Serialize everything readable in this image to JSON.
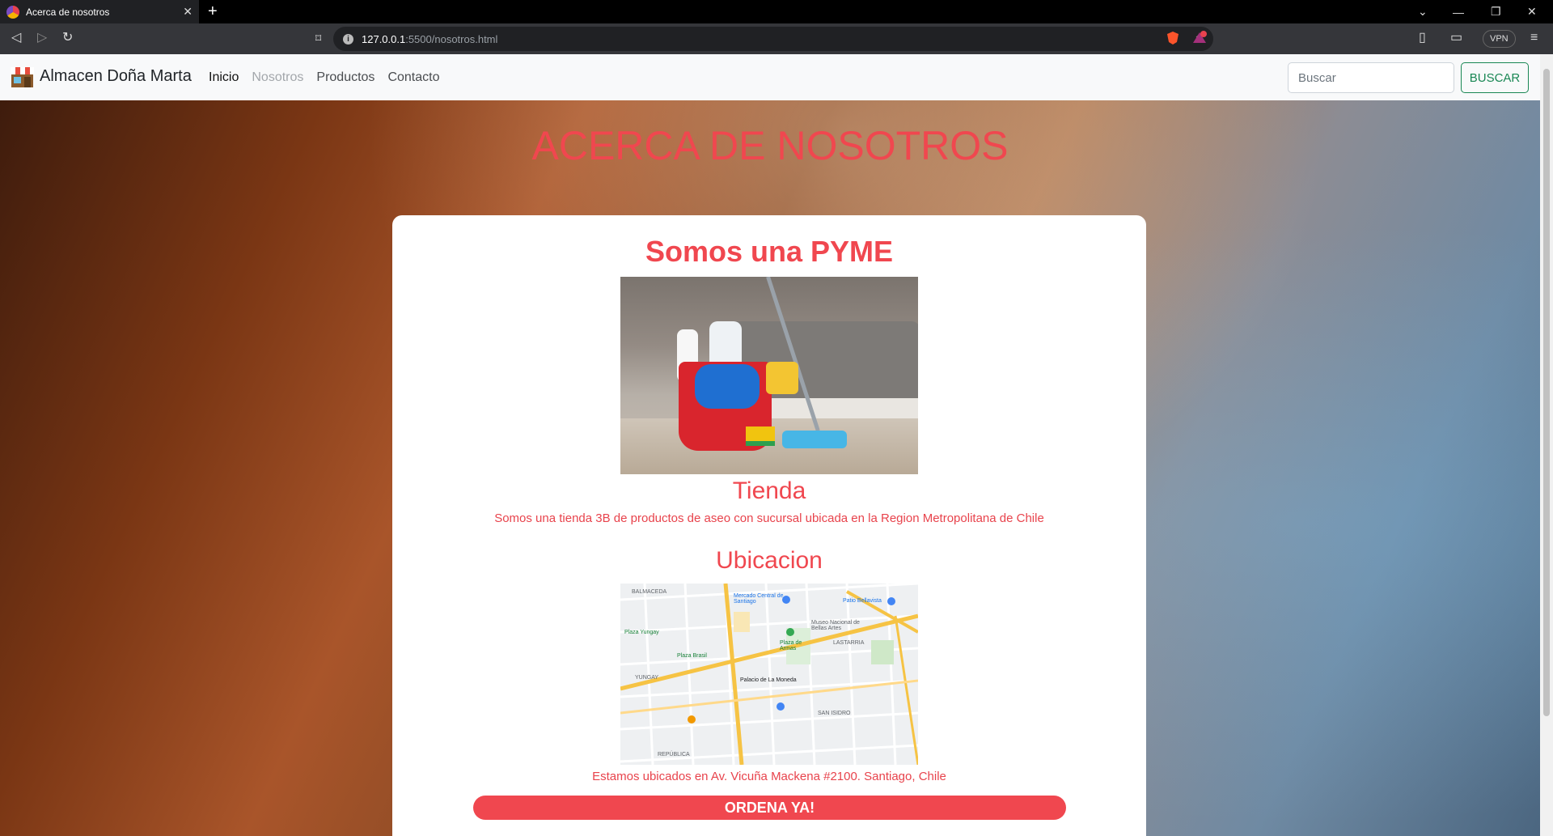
{
  "browser": {
    "tab_title": "Acerca de nosotros",
    "url_host": "127.0.0.1",
    "url_path": ":5500/nosotros.html",
    "vpn_label": "VPN",
    "new_tab_glyph": "+",
    "close_glyph": "✕"
  },
  "navbar": {
    "brand": "Almacen Doña Marta",
    "links": [
      "Inicio",
      "Nosotros",
      "Productos",
      "Contacto"
    ],
    "search_placeholder": "Buscar",
    "search_button": "BUSCAR"
  },
  "page": {
    "hero_title": "ACERCA DE NOSOTROS",
    "card_title": "Somos una PYME",
    "store_heading": "Tienda",
    "store_text": "Somos una tienda 3B de productos de aseo con sucursal ubicada en la Region Metropolitana de Chile",
    "location_heading": "Ubicacion",
    "location_text": "Estamos ubicados en Av. Vicuña Mackena #2100. Santiago, Chile",
    "order_button": "ORDENA YA!"
  },
  "map_labels": {
    "balmaceda": "BALMACEDA",
    "mercado": "Mercado Central de Santiago",
    "patio": "Patio Bellavista",
    "museo": "Museo Nacional de Bellas Artes",
    "yungay_plaza": "Plaza Yungay",
    "plaza_armas": "Plaza de Armas",
    "lastarria": "LASTARRIA",
    "plaza_brasil": "Plaza Brasil",
    "yungay": "YUNGAY",
    "moneda": "Palacio de La Moneda",
    "san_isidro": "SAN ISIDRO",
    "republica": "REPÚBLICA"
  },
  "colors": {
    "accent": "#f0474f",
    "search_button": "#198754",
    "navbar_bg": "#f8f9fa"
  }
}
